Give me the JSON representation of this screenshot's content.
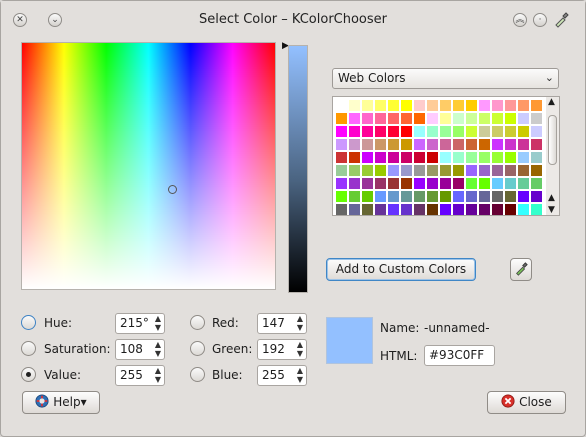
{
  "window": {
    "title": "Select Color – KColorChooser"
  },
  "picker": {
    "palette_label": "Web Colors",
    "add_custom_label": "Add to Custom Colors"
  },
  "fields": {
    "hue_label": "Hue:",
    "saturation_label": "Saturation:",
    "value_label": "Value:",
    "red_label": "Red:",
    "green_label": "Green:",
    "blue_label": "Blue:",
    "hue": "215°",
    "saturation": "108",
    "value": "255",
    "red": "147",
    "green": "192",
    "blue": "255"
  },
  "info": {
    "name_label": "Name:",
    "name_value": "-unnamed-",
    "html_label": "HTML:",
    "html_value": "#93C0FF"
  },
  "buttons": {
    "help": "Help",
    "close": "Close"
  },
  "colors": {
    "current": "#93C0FF",
    "swatches": [
      "#ffffff",
      "#ffffcc",
      "#ffff99",
      "#ffff66",
      "#ffff33",
      "#ffff00",
      "#ffcccc",
      "#ffcc99",
      "#ffcc66",
      "#ffcc33",
      "#ffcc00",
      "#ff99ff",
      "#ff99cc",
      "#ff9999",
      "#ff9966",
      "#ff9933",
      "#ff9900",
      "#ff66ff",
      "#ff66cc",
      "#ff6699",
      "#ff6666",
      "#ff6633",
      "#ff6600",
      "#ffccff",
      "#ffff99",
      "#ccffcc",
      "#ccff99",
      "#ccff66",
      "#ccff33",
      "#ccff00",
      "#ccccff",
      "#cccccc",
      "#ff00ff",
      "#ff00cc",
      "#ff0099",
      "#ff0066",
      "#ff0033",
      "#ff0000",
      "#99ffff",
      "#99ffcc",
      "#99ff99",
      "#99ff66",
      "#ccff33",
      "#cccc99",
      "#cccc66",
      "#cccc33",
      "#cccc00",
      "#ccccff",
      "#cc99ff",
      "#cc99cc",
      "#cc9999",
      "#cc9966",
      "#cc9933",
      "#cc9900",
      "#cc66ff",
      "#cc66cc",
      "#cc6699",
      "#cc6666",
      "#cc6633",
      "#cc6600",
      "#cc33ff",
      "#cc33cc",
      "#cc3399",
      "#cc3366",
      "#cc3333",
      "#cc3300",
      "#cc00ff",
      "#cc00cc",
      "#cc0099",
      "#cc0066",
      "#cc0033",
      "#cc0000",
      "#99ffff",
      "#99ffcc",
      "#99ff99",
      "#99ff66",
      "#99ff33",
      "#99ff00",
      "#99ccff",
      "#99cccc",
      "#99cc99",
      "#99cc66",
      "#99cc33",
      "#99cc00",
      "#9999ff",
      "#9999cc",
      "#999999",
      "#999966",
      "#999933",
      "#999900",
      "#9966ff",
      "#9966cc",
      "#996699",
      "#996666",
      "#996633",
      "#996600",
      "#9933ff",
      "#9933cc",
      "#993399",
      "#993366",
      "#993333",
      "#993300",
      "#9900ff",
      "#9900cc",
      "#990099",
      "#990066",
      "#66ff33",
      "#66ff00",
      "#66ccff",
      "#66cccc",
      "#66cc99",
      "#66cc66",
      "#66ff00",
      "#66cc33",
      "#66cc00",
      "#6699ff",
      "#6699cc",
      "#669999",
      "#669966",
      "#669933",
      "#669900",
      "#6666ff",
      "#6666cc",
      "#666699",
      "#666666",
      "#666633",
      "#6600ff",
      "#6600cc",
      "#666666",
      "#666699",
      "#666633",
      "#663399",
      "#6633ff",
      "#6633cc",
      "#663366",
      "#663300",
      "#6600ff",
      "#6600cc",
      "#660099",
      "#660066",
      "#660033",
      "#660000",
      "#33ffff",
      "#33ffcc"
    ]
  }
}
